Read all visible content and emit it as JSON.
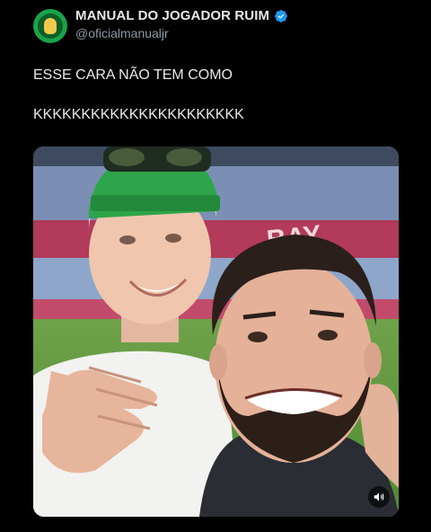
{
  "author": {
    "display_name": "MANUAL DO JOGADOR RUIM",
    "handle": "@oficialmanualjr",
    "verified": true,
    "avatar_icon": "avatar-logo"
  },
  "tweet": {
    "lines": [
      "ESSE CARA NÃO TEM COMO",
      "KKKKKKKKKKKKKKKKKKKKKK"
    ]
  },
  "media": {
    "type": "video",
    "mute_icon": "speaker-icon",
    "stadium_lettering": "BAY"
  },
  "colors": {
    "background": "#000000",
    "text": "#e7e9ea",
    "secondary_text": "#8b98a5",
    "verified": "#1d9bf0",
    "avatar": "#1aa34a"
  }
}
